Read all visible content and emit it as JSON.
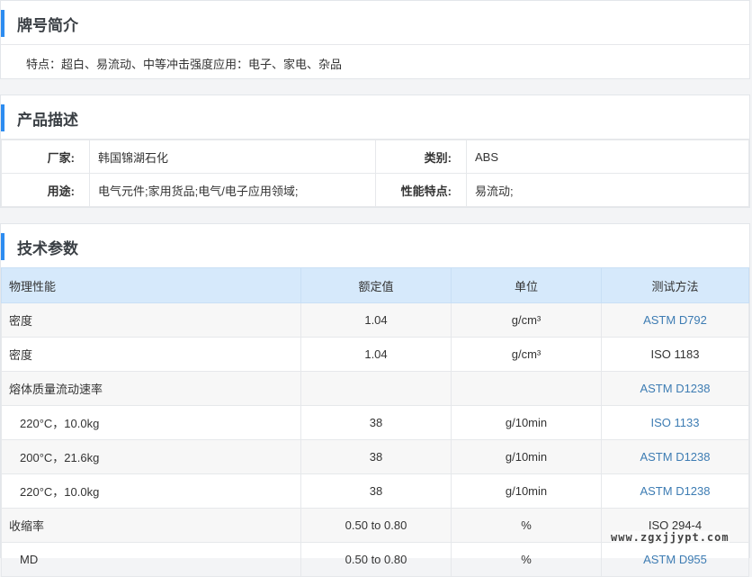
{
  "brand_intro": {
    "title": "牌号简介",
    "features": "特点：超白、易流动、中等冲击强度应用：电子、家电、杂品"
  },
  "product_desc": {
    "title": "产品描述",
    "rows": [
      {
        "k1": "厂家:",
        "v1": "韩国锦湖石化",
        "k2": "类别:",
        "v2": "ABS"
      },
      {
        "k1": "用途:",
        "v1": "电气元件;家用货品;电气/电子应用领域;",
        "k2": "性能特点:",
        "v2": "易流动;"
      }
    ]
  },
  "tech_params": {
    "title": "技术参数",
    "headers": [
      "物理性能",
      "额定值",
      "单位",
      "测试方法"
    ],
    "rows": [
      {
        "prop": "密度",
        "value": "1.04",
        "unit": "g/cm³",
        "method": "ASTM D792",
        "link": true,
        "sub": false
      },
      {
        "prop": "密度",
        "value": "1.04",
        "unit": "g/cm³",
        "method": "ISO 1183",
        "link": false,
        "sub": false
      },
      {
        "prop": "熔体质量流动速率",
        "value": "",
        "unit": "",
        "method": "ASTM D1238",
        "link": true,
        "sub": false
      },
      {
        "prop": "220°C，10.0kg",
        "value": "38",
        "unit": "g/10min",
        "method": "ISO 1133",
        "link": true,
        "sub": true
      },
      {
        "prop": "200°C，21.6kg",
        "value": "38",
        "unit": "g/10min",
        "method": "ASTM D1238",
        "link": true,
        "sub": true
      },
      {
        "prop": "220°C，10.0kg",
        "value": "38",
        "unit": "g/10min",
        "method": "ASTM D1238",
        "link": true,
        "sub": true
      },
      {
        "prop": "收缩率",
        "value": "0.50 to 0.80",
        "unit": "%",
        "method": "ISO 294-4",
        "link": false,
        "sub": false
      },
      {
        "prop": "MD",
        "value": "0.50 to 0.80",
        "unit": "%",
        "method": "ASTM D955",
        "link": true,
        "sub": true
      }
    ]
  },
  "watermark": "www.zgxjjypt.com",
  "colors": {
    "accent": "#2d8cf0",
    "header_bg": "#d6e9fb",
    "link": "#3d7cb3"
  }
}
